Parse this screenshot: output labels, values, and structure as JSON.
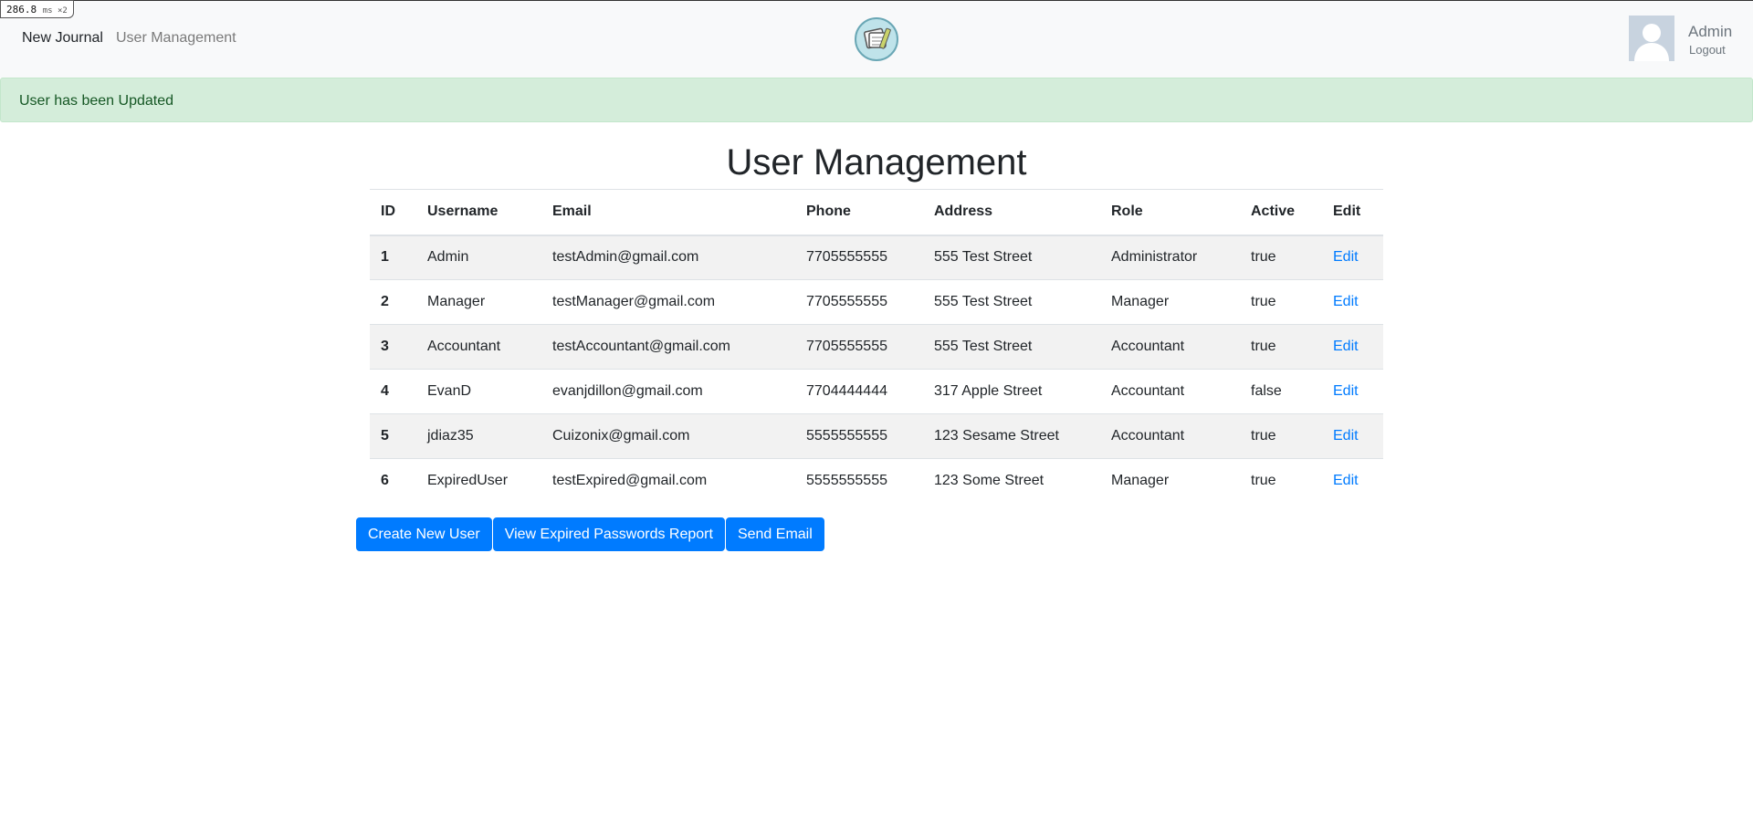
{
  "perf": {
    "value": "286.8",
    "unit": "ms ×2"
  },
  "navbar": {
    "brand": "New Journal",
    "link": "User Management",
    "logo_icon": "journal-logo-icon",
    "user": {
      "name": "Admin",
      "logout": "Logout",
      "avatar_icon": "user-avatar-icon"
    }
  },
  "alert": {
    "message": "User has been Updated",
    "color": "#d4edda"
  },
  "page": {
    "title": "User Management"
  },
  "table": {
    "headers": [
      "ID",
      "Username",
      "Email",
      "Phone",
      "Address",
      "Role",
      "Active",
      "Edit"
    ],
    "rows": [
      {
        "id": "1",
        "username": "Admin",
        "email": "testAdmin@gmail.com",
        "phone": "7705555555",
        "address": "555 Test Street",
        "role": "Administrator",
        "active": "true",
        "edit": "Edit"
      },
      {
        "id": "2",
        "username": "Manager",
        "email": "testManager@gmail.com",
        "phone": "7705555555",
        "address": "555 Test Street",
        "role": "Manager",
        "active": "true",
        "edit": "Edit"
      },
      {
        "id": "3",
        "username": "Accountant",
        "email": "testAccountant@gmail.com",
        "phone": "7705555555",
        "address": "555 Test Street",
        "role": "Accountant",
        "active": "true",
        "edit": "Edit"
      },
      {
        "id": "4",
        "username": "EvanD",
        "email": "evanjdillon@gmail.com",
        "phone": "7704444444",
        "address": "317 Apple Street",
        "role": "Accountant",
        "active": "false",
        "edit": "Edit"
      },
      {
        "id": "5",
        "username": "jdiaz35",
        "email": "Cuizonix@gmail.com",
        "phone": "5555555555",
        "address": "123 Sesame Street",
        "role": "Accountant",
        "active": "true",
        "edit": "Edit"
      },
      {
        "id": "6",
        "username": "ExpiredUser",
        "email": "testExpired@gmail.com",
        "phone": "5555555555",
        "address": "123 Some Street",
        "role": "Manager",
        "active": "true",
        "edit": "Edit"
      }
    ]
  },
  "actions": {
    "create": "Create New User",
    "report": "View Expired Passwords Report",
    "email": "Send Email",
    "color": "#007bff"
  }
}
